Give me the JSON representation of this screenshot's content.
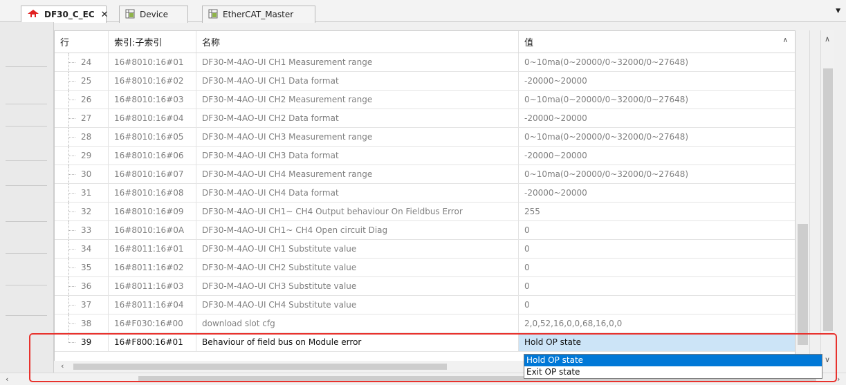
{
  "tabs": [
    {
      "label": "DF30_C_EC",
      "icon": "device-red-icon",
      "closable": true,
      "active": true
    },
    {
      "label": "Device",
      "icon": "grid-doc-icon",
      "active": false
    },
    {
      "label": "EtherCAT_Master",
      "icon": "grid-doc-icon",
      "active": false
    }
  ],
  "table": {
    "headers": {
      "row": "行",
      "index": "索引:子索引",
      "name": "名称",
      "value": "值"
    },
    "rows": [
      {
        "row": "24",
        "index": "16#8010:16#01",
        "name": "DF30-M-4AO-UI CH1 Measurement range",
        "value": "0~10ma(0~20000/0~32000/0~27648)"
      },
      {
        "row": "25",
        "index": "16#8010:16#02",
        "name": "DF30-M-4AO-UI CH1 Data format",
        "value": "-20000~20000"
      },
      {
        "row": "26",
        "index": "16#8010:16#03",
        "name": "DF30-M-4AO-UI CH2 Measurement range",
        "value": "0~10ma(0~20000/0~32000/0~27648)"
      },
      {
        "row": "27",
        "index": "16#8010:16#04",
        "name": "DF30-M-4AO-UI CH2 Data format",
        "value": "-20000~20000"
      },
      {
        "row": "28",
        "index": "16#8010:16#05",
        "name": "DF30-M-4AO-UI CH3 Measurement range",
        "value": "0~10ma(0~20000/0~32000/0~27648)"
      },
      {
        "row": "29",
        "index": "16#8010:16#06",
        "name": "DF30-M-4AO-UI CH3 Data format",
        "value": "-20000~20000"
      },
      {
        "row": "30",
        "index": "16#8010:16#07",
        "name": "DF30-M-4AO-UI CH4 Measurement range",
        "value": "0~10ma(0~20000/0~32000/0~27648)"
      },
      {
        "row": "31",
        "index": "16#8010:16#08",
        "name": "DF30-M-4AO-UI CH4 Data format",
        "value": "-20000~20000"
      },
      {
        "row": "32",
        "index": "16#8010:16#09",
        "name": "DF30-M-4AO-UI CH1~ CH4 Output behaviour On Fieldbus Error",
        "value": "255"
      },
      {
        "row": "33",
        "index": "16#8010:16#0A",
        "name": "DF30-M-4AO-UI CH1~ CH4 Open circuit Diag",
        "value": "0"
      },
      {
        "row": "34",
        "index": "16#8011:16#01",
        "name": "DF30-M-4AO-UI CH1 Substitute value",
        "value": "0"
      },
      {
        "row": "35",
        "index": "16#8011:16#02",
        "name": "DF30-M-4AO-UI CH2 Substitute value",
        "value": "0"
      },
      {
        "row": "36",
        "index": "16#8011:16#03",
        "name": "DF30-M-4AO-UI CH3 Substitute value",
        "value": "0"
      },
      {
        "row": "37",
        "index": "16#8011:16#04",
        "name": "DF30-M-4AO-UI CH4 Substitute value",
        "value": "0"
      },
      {
        "row": "38",
        "index": "16#F030:16#00",
        "name": "download slot cfg",
        "value": "2,0,52,16,0,0,68,16,0,0"
      },
      {
        "row": "39",
        "index": "16#F800:16#01",
        "name": "Behaviour of field bus on Module error",
        "value": "Hold OP state"
      }
    ]
  },
  "dropdown": {
    "options": [
      "Hold OP state",
      "Exit OP state"
    ],
    "highlighted": "Hold OP state"
  },
  "colors": {
    "highlight": "#0078d7",
    "annotation": "#e8322d",
    "selected_value_bg": "#cce4f7"
  }
}
